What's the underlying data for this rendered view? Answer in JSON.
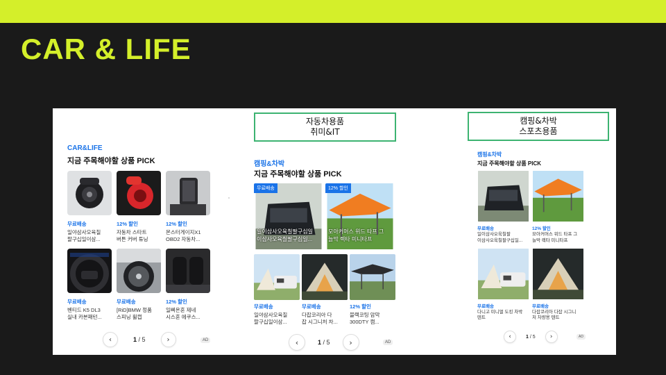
{
  "slide": {
    "title": "CAR & LIFE"
  },
  "colors": {
    "accent": "#d4ef2a",
    "brand_blue": "#1a73e8",
    "box_border": "#3cb371",
    "background": "#1a1a1a"
  },
  "category_boxes": [
    {
      "line1": "자동차용품",
      "line2": "취미&IT"
    },
    {
      "line1": "캠핑&차박",
      "line2": "스포츠용품"
    }
  ],
  "panels": [
    {
      "brand": "CAR&LIFE",
      "heading": "지금 주목해야할 상품 PICK",
      "products": [
        {
          "tag": "무료배송",
          "name_line1": "일야삼사오육칠",
          "name_line2": "팔구십일이삼...",
          "image": "car-phone-holder-image"
        },
        {
          "tag": "12% 할인",
          "name_line1": "자동차 스타트",
          "name_line2": "버튼 커버 튜닝",
          "image": "red-start-button-cover-image"
        },
        {
          "tag": "12% 할인",
          "name_line1": "몬스터게이지X1",
          "name_line2": "OBD2 자동차...",
          "image": "dashboard-phone-mount-image"
        },
        {
          "tag": "무료배송",
          "name_line1": "벤티드 K5 DL3",
          "name_line2": "실내 카본패턴...",
          "image": "steering-wheel-image"
        },
        {
          "tag": "무료배송",
          "name_line1": "[RiD]BMW 정품",
          "name_line2": "스피닝 휠캡",
          "image": "car-wheel-image"
        },
        {
          "tag": "12% 할인",
          "name_line1": "일삐온혼 제네",
          "name_line2": "시스혼 에쿠스...",
          "image": "car-seat-interior-image"
        }
      ],
      "pager": {
        "current": "1",
        "total": "/ 5",
        "ad": "AD"
      }
    },
    {
      "brand": "캠핑&차박",
      "heading": "지금 주목해야할 상품 PICK",
      "products": [
        {
          "badge": "무료배송",
          "overlay_line1": "일이삼사오육칠팔구십일",
          "overlay_line2": "이삼사오육칠팔구십일...",
          "image": "suv-tailgate-tent-image"
        },
        {
          "badge": "12% 할인",
          "overlay_line1": "모아커머스 위드 타프 그",
          "overlay_line2": "늘막 렉타 미니타프",
          "image": "orange-tarp-image"
        },
        {
          "tag": "무료배송",
          "name_line1": "일야삼사오육칠",
          "name_line2": "팔구십일이삼...",
          "image": "car-awning-tent-image"
        },
        {
          "tag": "무료배송",
          "name_line1": "다잡코리아 다",
          "name_line2": "잡 시그니처 차...",
          "image": "lit-camping-tent-image"
        },
        {
          "tag": "12% 할인",
          "name_line1": "블랙코팅 암막",
          "name_line2": "300DTY 캠...",
          "image": "black-tarp-image"
        }
      ],
      "pager": {
        "current": "1",
        "total": "/ 5",
        "ad": "AD"
      }
    },
    {
      "brand": "캠핑&차박",
      "heading": "지금 주목해야할 상품 PICK",
      "products": [
        {
          "tag": "무료배송",
          "name_line1": "일이삼사오육칠팔",
          "name_line2": "이삼사오육칠팔구십일...",
          "image": "suv-tailgate-tent-image"
        },
        {
          "tag": "12% 할인",
          "name_line1": "모아커머스 위드 타프 그",
          "name_line2": "늘막 렉타 미니타프",
          "image": "orange-tarp-image"
        },
        {
          "tag": "무료배송",
          "name_line1": "다니고 미니멀 도킹 차박",
          "name_line2": "텐트",
          "image": "car-awning-tent-image"
        },
        {
          "tag": "무료배송",
          "name_line1": "다잡코리아 다잡 시그니",
          "name_line2": "처 차량용 텐트",
          "image": "lit-camping-tent-image"
        }
      ],
      "pager": {
        "current": "1",
        "total": "/ 5",
        "ad": "AD"
      }
    }
  ]
}
